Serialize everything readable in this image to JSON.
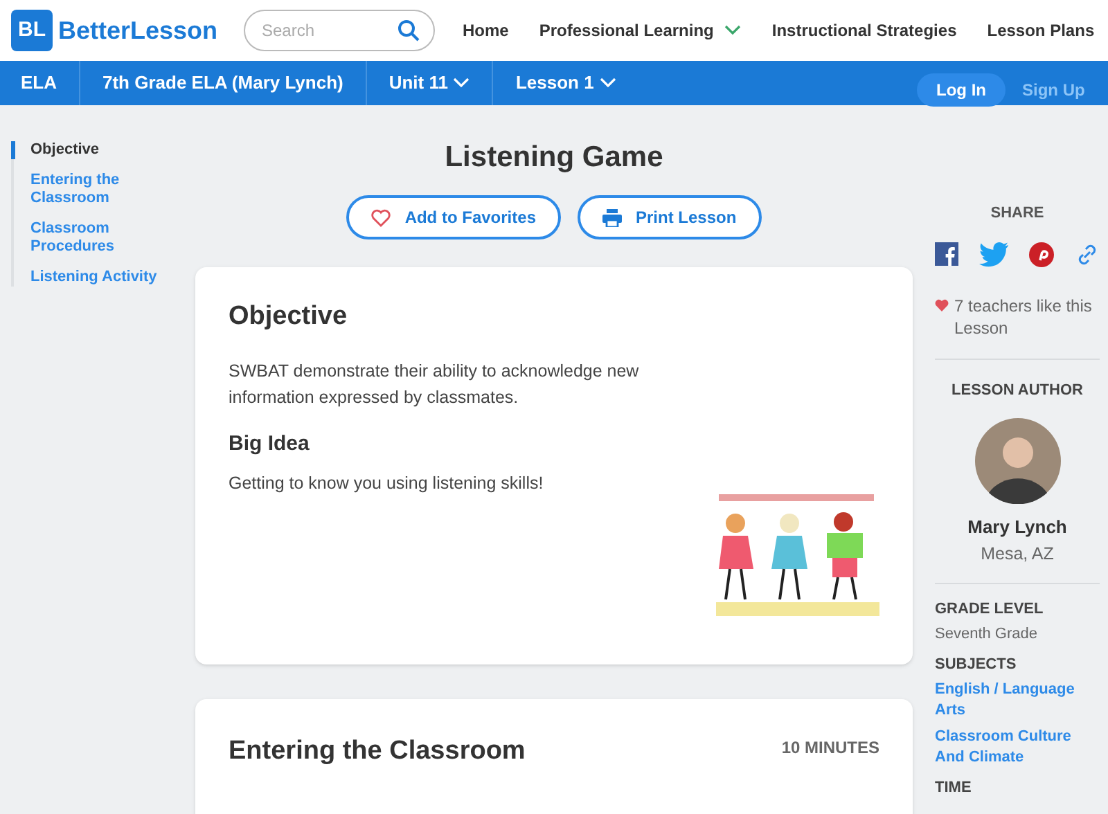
{
  "header": {
    "logo_mark": "BL",
    "logo_text": "BetterLesson",
    "search": {
      "placeholder": "Search"
    },
    "nav": [
      {
        "label": "Home",
        "dropdown": false
      },
      {
        "label": "Professional Learning",
        "dropdown": true
      },
      {
        "label": "Instructional Strategies",
        "dropdown": false
      },
      {
        "label": "Lesson Plans",
        "dropdown": false
      }
    ]
  },
  "breadcrumb": [
    {
      "label": "ELA",
      "dropdown": false
    },
    {
      "label": "7th Grade ELA (Mary Lynch)",
      "dropdown": false
    },
    {
      "label": "Unit 11",
      "dropdown": true
    },
    {
      "label": "Lesson 1",
      "dropdown": true
    }
  ],
  "auth": {
    "login": "Log In",
    "signup": "Sign Up"
  },
  "sidebar": {
    "items": [
      {
        "label": "Objective",
        "selected": true
      },
      {
        "label": "Entering the Classroom",
        "selected": false
      },
      {
        "label": "Classroom Procedures",
        "selected": false
      },
      {
        "label": "Listening Activity",
        "selected": false
      }
    ]
  },
  "lesson": {
    "title": "Listening Game",
    "actions": [
      {
        "kind": "favorite",
        "label": "Add to Favorites"
      },
      {
        "kind": "print",
        "label": "Print Lesson"
      }
    ]
  },
  "sections": [
    {
      "title": "Objective",
      "body": "SWBAT demonstrate their ability to acknowledge new information expressed by classmates.",
      "subtitle": "Big Idea",
      "subbody": "Getting to know you using listening skills!"
    },
    {
      "title": "Entering the Classroom",
      "duration": "10 MINUTES"
    }
  ],
  "share": {
    "heading": "SHARE",
    "networks": [
      {
        "kind": "facebook"
      },
      {
        "kind": "twitter"
      },
      {
        "kind": "pinterest"
      },
      {
        "kind": "link"
      }
    ]
  },
  "likes": "7 teachers like this Lesson",
  "author": {
    "heading": "LESSON AUTHOR",
    "name": "Mary Lynch",
    "location": "Mesa, AZ"
  },
  "details": [
    {
      "heading": "GRADE LEVEL",
      "values": [
        {
          "text": "Seventh Grade",
          "link": false
        }
      ]
    },
    {
      "heading": "SUBJECTS",
      "values": [
        {
          "text": "English / Language Arts",
          "link": true
        },
        {
          "text": "Classroom Culture And Climate",
          "link": true
        }
      ]
    },
    {
      "heading": "TIME"
    }
  ]
}
